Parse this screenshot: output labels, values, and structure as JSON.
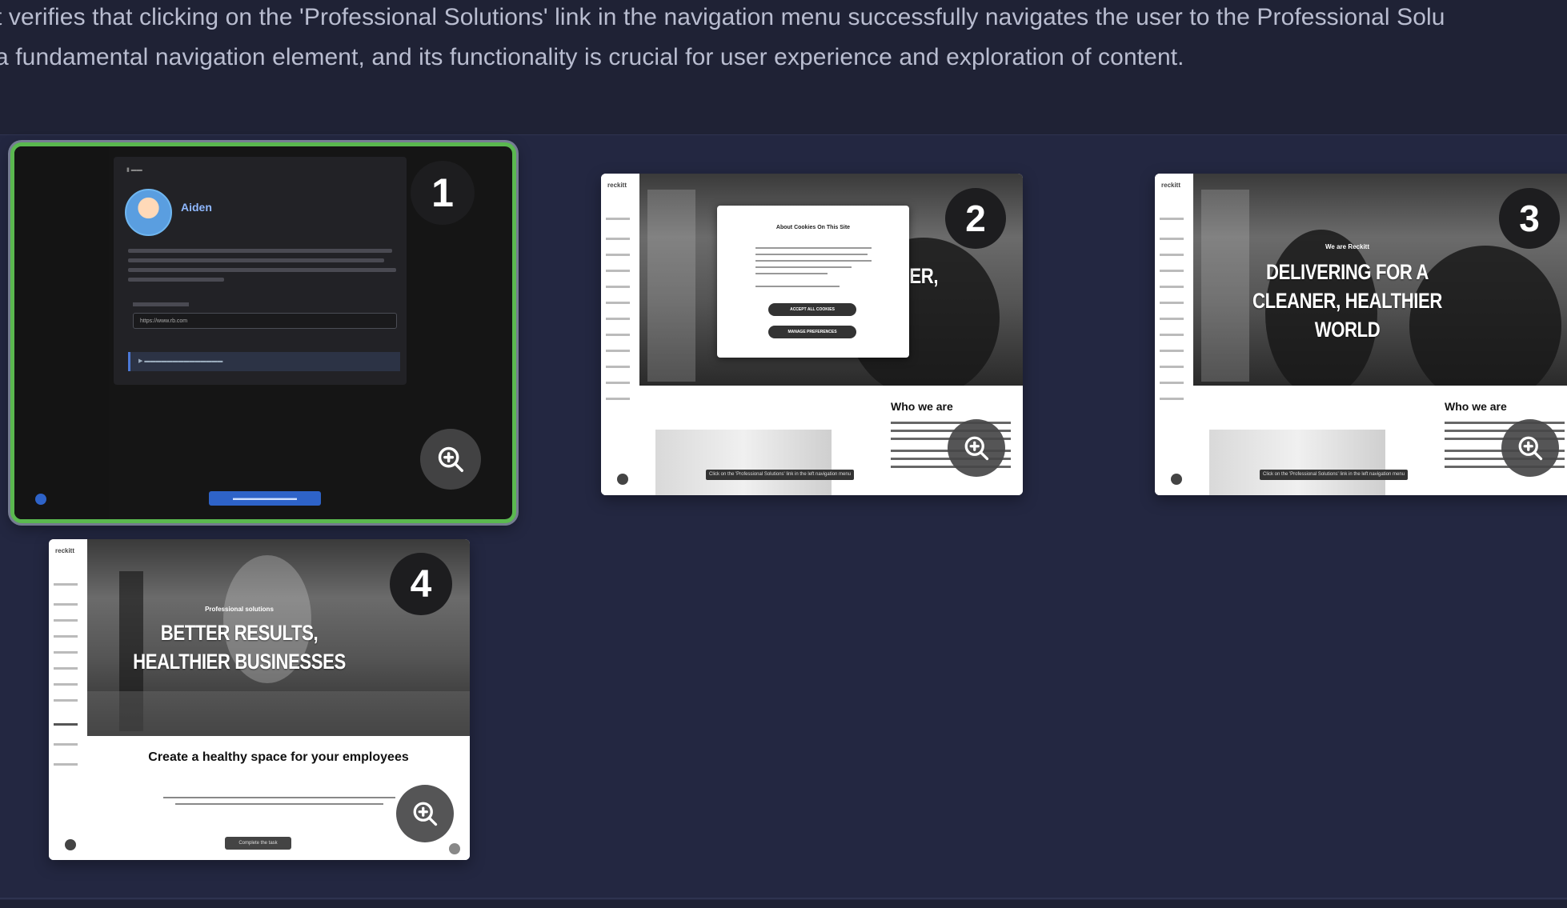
{
  "description": {
    "line1": "t verifies that clicking on the 'Professional Solutions' link in the navigation menu successfully navigates the user to the Professional Solu",
    "line2": "a fundamental navigation element, and its functionality is crucial for user experience and exploration of content."
  },
  "cards": [
    {
      "number": "1",
      "selected": true,
      "user_name": "Aiden"
    },
    {
      "number": "2",
      "hero_partial": "ER,",
      "section_heading": "Who we are",
      "cookie_title": "About Cookies On This Site",
      "cookie_accept": "ACCEPT ALL COOKIES",
      "cookie_manage": "MANAGE PREFERENCES"
    },
    {
      "number": "3",
      "eyebrow": "We are Reckitt",
      "hero_title": "DELIVERING FOR A CLEANER, HEALTHIER WORLD",
      "section_heading": "Who we are"
    },
    {
      "number": "4",
      "eyebrow": "Professional solutions",
      "hero_title": "BETTER RESULTS, HEALTHIER BUSINESSES",
      "section_heading": "Create a healthy space for your employees"
    }
  ],
  "icons": {
    "zoom": "zoom-in-icon"
  },
  "colors": {
    "background": "#1f2235",
    "panel": "#232741",
    "selected_border": "#5ab84f",
    "badge": "#1d1d1f"
  }
}
